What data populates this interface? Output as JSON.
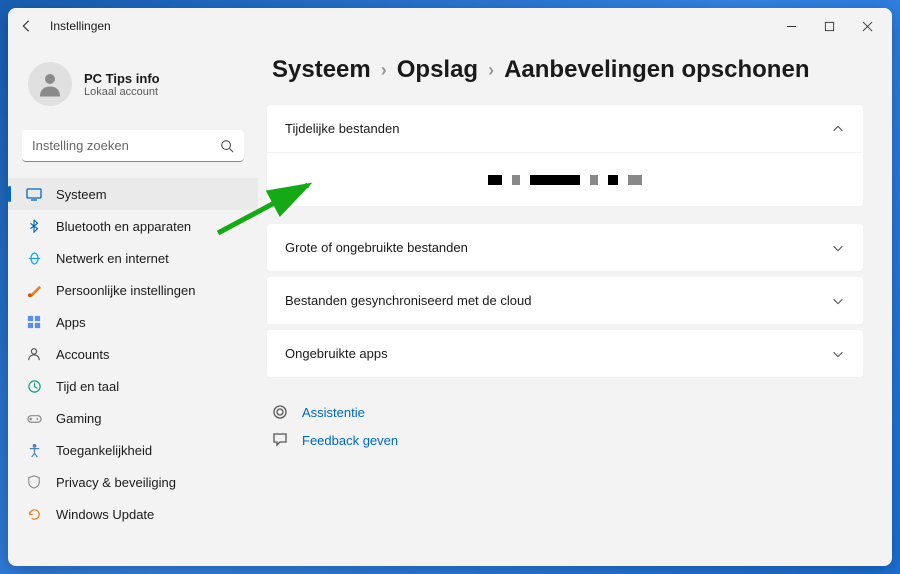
{
  "titlebar": {
    "title": "Instellingen"
  },
  "user": {
    "name": "PC Tips info",
    "account_type": "Lokaal account"
  },
  "search": {
    "placeholder": "Instelling zoeken"
  },
  "sidebar": {
    "items": [
      {
        "label": "Systeem",
        "active": true
      },
      {
        "label": "Bluetooth en apparaten"
      },
      {
        "label": "Netwerk en internet"
      },
      {
        "label": "Persoonlijke instellingen"
      },
      {
        "label": "Apps"
      },
      {
        "label": "Accounts"
      },
      {
        "label": "Tijd en taal"
      },
      {
        "label": "Gaming"
      },
      {
        "label": "Toegankelijkheid"
      },
      {
        "label": "Privacy & beveiliging"
      },
      {
        "label": "Windows Update"
      }
    ]
  },
  "breadcrumb": {
    "level1": "Systeem",
    "level2": "Opslag",
    "level3": "Aanbevelingen opschonen"
  },
  "panels": [
    {
      "title": "Tijdelijke bestanden",
      "expanded": true
    },
    {
      "title": "Grote of ongebruikte bestanden"
    },
    {
      "title": "Bestanden gesynchroniseerd met de cloud"
    },
    {
      "title": "Ongebruikte apps"
    }
  ],
  "helpers": {
    "assist": "Assistentie",
    "feedback": "Feedback geven"
  }
}
